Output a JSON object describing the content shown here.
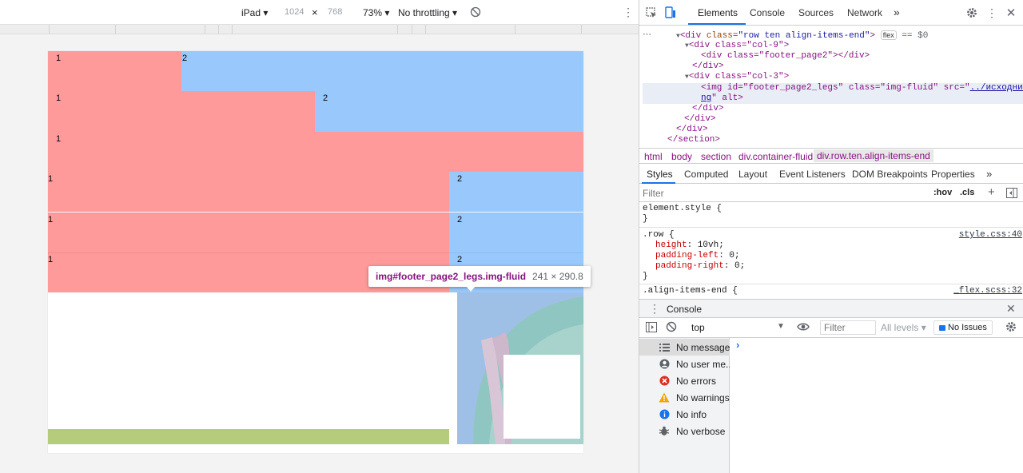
{
  "device_toolbar": {
    "device": "iPad",
    "width": "1024",
    "height": "768",
    "times": "×",
    "zoom": "73%",
    "throttling": "No throttling"
  },
  "page": {
    "rows": [
      {
        "left": "1",
        "right": "2"
      },
      {
        "left": "1",
        "right": "2"
      },
      {
        "left": "1"
      },
      {
        "left": "1",
        "right": "2"
      },
      {
        "left": "1",
        "right": "2"
      },
      {
        "left": "1",
        "right": "2"
      }
    ],
    "colors": {
      "pink": "#ff9a9a",
      "blue": "#99c9fc",
      "green": "#b5cc7c",
      "teal": "#8fc6c1"
    }
  },
  "tooltip": {
    "selector": "img#footer_page2_legs.img-fluid",
    "dims": "241 × 290.8"
  },
  "devtools": {
    "tabs": [
      "Elements",
      "Console",
      "Sources",
      "Network"
    ],
    "more": "»",
    "dom": {
      "line0": "-->",
      "line1_tag_open": "<div ",
      "line1_attr": "class",
      "line1_val": "\"row ten align-items-end\"",
      "line1_close": ">",
      "line1_badge": "flex",
      "line1_eq": "== $0",
      "line2": "<div class=\"col-9\">",
      "line3": "<div class=\"footer_page2\"></div>",
      "line4": "</div>",
      "line5": "<div class=\"col-3\">",
      "line6_a": "<img id=\"footer_page2_legs\" class=\"img-fluid\" src=\"",
      "line6_link": "../исходники/7.p",
      "line7_link": "ng",
      "line7_b": "\" alt>",
      "line8": "</div>",
      "line9": "</div>",
      "line10": "</div>",
      "line11": "</section>"
    },
    "breadcrumbs": [
      "html",
      "body",
      "section",
      "div.container-fluid",
      "div.row.ten.align-items-end"
    ],
    "sub_tabs": [
      "Styles",
      "Computed",
      "Layout",
      "Event Listeners",
      "DOM Breakpoints",
      "Properties",
      "»"
    ],
    "filter_placeholder": "Filter",
    "hov": ":hov",
    "cls": ".cls",
    "styles": {
      "element_style": "element.style {",
      "close": "}",
      "row_selector": ".row {",
      "row_src": "style.css:40",
      "props": [
        {
          "name": "height",
          "value": "10vh;"
        },
        {
          "name": "padding-left",
          "value": "0;"
        },
        {
          "name": "padding-right",
          "value": "0;"
        }
      ],
      "align_selector": ".align-items-end {",
      "align_src": "_flex.scss:32"
    },
    "drawer": {
      "title": "Console",
      "context": "top",
      "filter_placeholder": "Filter",
      "levels": "All levels",
      "issues": "No Issues",
      "messages": [
        {
          "label": "No messages",
          "icon": "list-icon"
        },
        {
          "label": "No user me...",
          "icon": "user-icon"
        },
        {
          "label": "No errors",
          "icon": "error-icon"
        },
        {
          "label": "No warnings",
          "icon": "warning-icon"
        },
        {
          "label": "No info",
          "icon": "info-icon"
        },
        {
          "label": "No verbose",
          "icon": "bug-icon"
        }
      ],
      "prompt": "›"
    }
  }
}
